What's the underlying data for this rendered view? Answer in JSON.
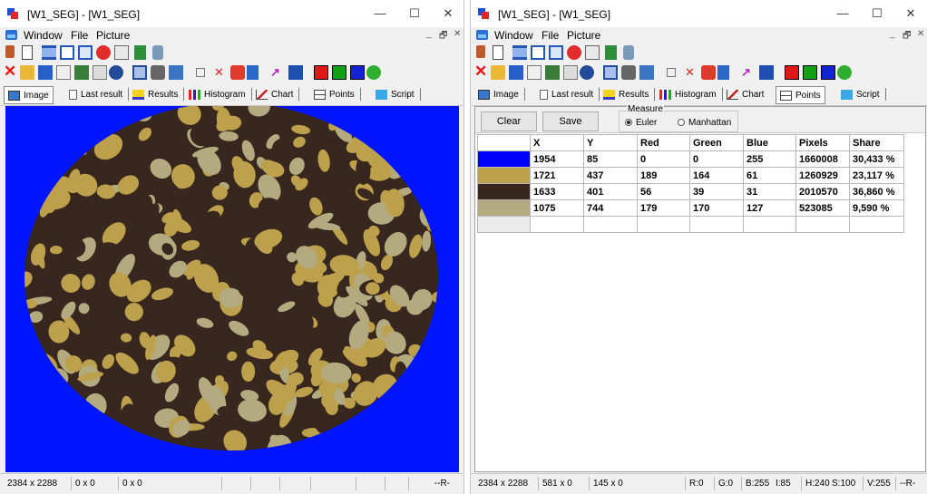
{
  "left_window": {
    "title": "[W1_SEG] - [W1_SEG]",
    "menu": [
      "Window",
      "File",
      "Picture"
    ],
    "tabs": [
      {
        "label": "Image",
        "icon": "image-icon"
      },
      {
        "label": "Last result",
        "icon": "document-icon"
      },
      {
        "label": "Results",
        "icon": "results-icon"
      },
      {
        "label": "Histogram",
        "icon": "histogram-icon"
      },
      {
        "label": "Chart",
        "icon": "chart-icon"
      },
      {
        "label": "Points",
        "icon": "points-icon"
      },
      {
        "label": "Script",
        "icon": "script-icon"
      }
    ],
    "active_tab": "Image",
    "status": {
      "size": "2384 x 2288",
      "pos1": "0 x 0",
      "pos2": "0 x 0",
      "flag": "--R-"
    }
  },
  "right_window": {
    "title": "[W1_SEG] - [W1_SEG]",
    "menu": [
      "Window",
      "File",
      "Picture"
    ],
    "tabs": [
      {
        "label": "Image",
        "icon": "image-icon"
      },
      {
        "label": "Last result",
        "icon": "document-icon"
      },
      {
        "label": "Results",
        "icon": "results-icon"
      },
      {
        "label": "Histogram",
        "icon": "histogram-icon"
      },
      {
        "label": "Chart",
        "icon": "chart-icon"
      },
      {
        "label": "Points",
        "icon": "points-icon"
      },
      {
        "label": "Script",
        "icon": "script-icon"
      }
    ],
    "active_tab": "Points",
    "buttons": {
      "clear": "Clear",
      "save": "Save"
    },
    "measure": {
      "title": "Measure",
      "options": [
        "Euler",
        "Manhattan"
      ],
      "selected": "Euler"
    },
    "table": {
      "headers": [
        "",
        "X",
        "Y",
        "Red",
        "Green",
        "Blue",
        "Pixels",
        "Share"
      ],
      "rows": [
        {
          "color": "#0000ff",
          "x": "1954",
          "y": "85",
          "red": "0",
          "green": "0",
          "blue": "255",
          "pixels": "1660008",
          "share": "30,433 %"
        },
        {
          "color": "#bda04b",
          "x": "1721",
          "y": "437",
          "red": "189",
          "green": "164",
          "blue": "61",
          "pixels": "1260929",
          "share": "23,117 %"
        },
        {
          "color": "#38271f",
          "x": "1633",
          "y": "401",
          "red": "56",
          "green": "39",
          "blue": "31",
          "pixels": "2010570",
          "share": "36,860 %"
        },
        {
          "color": "#b3aa7f",
          "x": "1075",
          "y": "744",
          "red": "179",
          "green": "170",
          "blue": "127",
          "pixels": "523085",
          "share": "9,590 %"
        }
      ]
    },
    "status": {
      "size": "2384 x 2288",
      "pos1": "581 x 0",
      "pos2": "145 x 0",
      "r": "R:0",
      "g": "G:0",
      "b": "B:255",
      "i": "I:85",
      "h": "H:240",
      "s": "S:100",
      "v": "V:255",
      "flag": "--R-"
    }
  },
  "segment_colors": {
    "background": "#0015ff",
    "dark": "#38271f",
    "gold": "#bda04b",
    "grey": "#b3aa7f"
  },
  "window_controls": {
    "minimize": "—",
    "maximize": "☐",
    "close": "✕",
    "mdi_min": "_",
    "mdi_restore": "🗗",
    "mdi_close": "✕"
  }
}
